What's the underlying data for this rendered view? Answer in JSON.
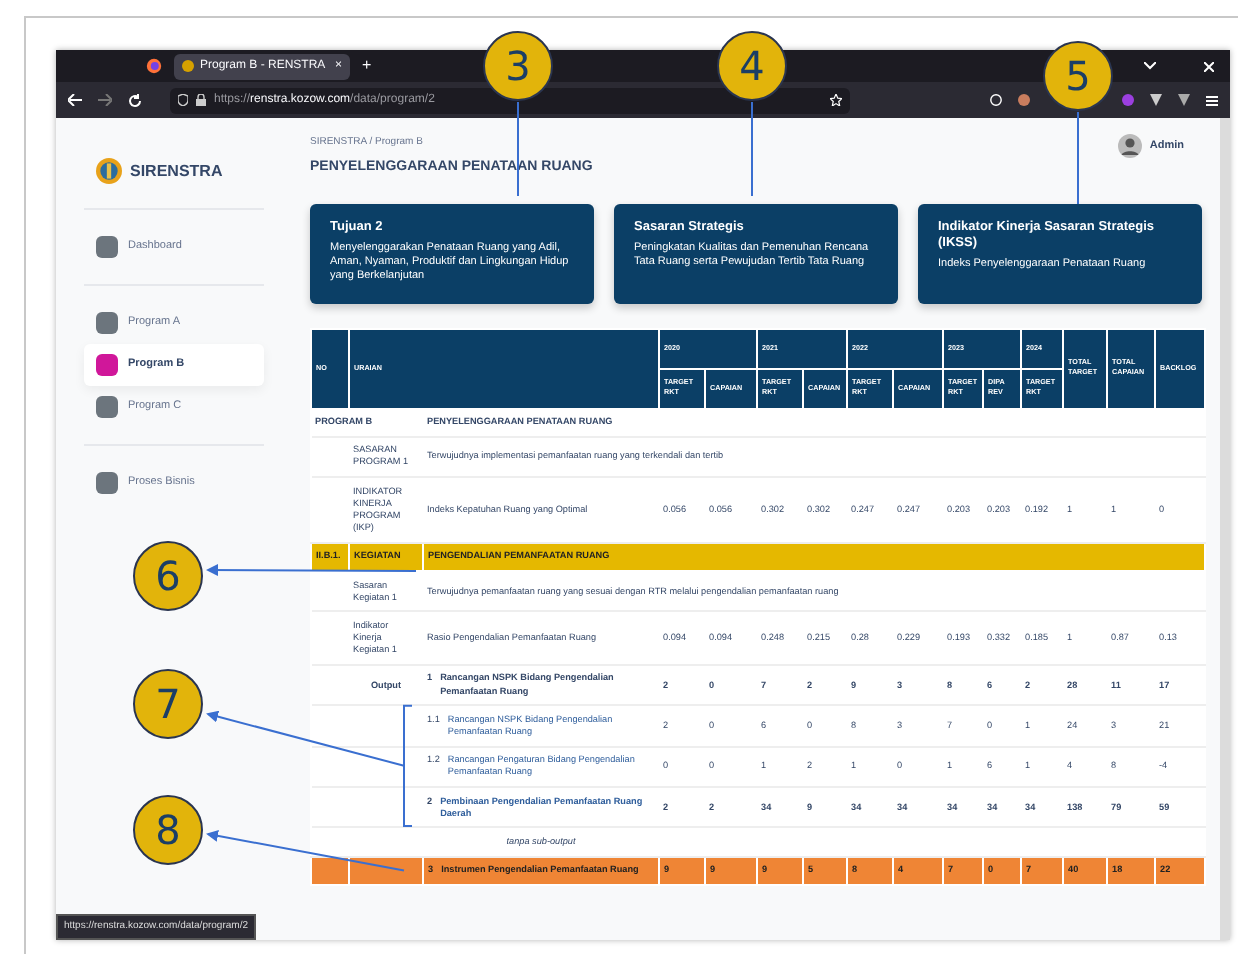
{
  "browser": {
    "tab_title": "Program B - RENSTRA",
    "tab_close": "×",
    "new_tab": "+",
    "url_scheme": "https://",
    "url_host": "renstra.kozow.com",
    "url_path": "/data/program/2",
    "status_url": "https://renstra.kozow.com/data/program/2"
  },
  "sidebar": {
    "brand": "SIRENSTRA",
    "groups": [
      [
        {
          "label": "Dashboard",
          "selected": false
        }
      ],
      [
        {
          "label": "Program A",
          "selected": false
        },
        {
          "label": "Program B",
          "selected": true
        },
        {
          "label": "Program C",
          "selected": false
        }
      ],
      [
        {
          "label": "Proses Bisnis",
          "selected": false
        }
      ]
    ]
  },
  "breadcrumb": {
    "items": [
      "SIRENSTRA",
      "Program B"
    ],
    "separator": "/"
  },
  "page_title": "PENYELENGGARAAN PENATAAN RUANG",
  "user": "Admin",
  "cards": [
    {
      "title": "Tujuan 2",
      "text": "Menyelenggarakan Penataan Ruang yang Adil, Aman, Nyaman, Produktif dan Lingkungan Hidup yang Berkelanjutan"
    },
    {
      "title": "Sasaran Strategis",
      "text": "Peningkatan Kualitas dan Pemenuhan Rencana Tata Ruang serta Pewujudan Tertib Tata Ruang"
    },
    {
      "title": "Indikator Kinerja Sasaran Strategis (IKSS)",
      "text": "Indeks Penyelenggaraan Penataan Ruang"
    }
  ],
  "table": {
    "columns": [
      {
        "label": "NO"
      },
      {
        "label": "URAIAN"
      },
      {
        "label": "2020",
        "sub": [
          "TARGET RKT",
          "CAPAIAN"
        ]
      },
      {
        "label": "2021",
        "sub": [
          "TARGET RKT",
          "CAPAIAN"
        ]
      },
      {
        "label": "2022",
        "sub": [
          "TARGET RKT",
          "CAPAIAN"
        ]
      },
      {
        "label": "2023",
        "sub": [
          "TARGET RKT",
          "DIPA REV"
        ]
      },
      {
        "label": "2024",
        "sub": [
          "TARGET RKT"
        ]
      },
      {
        "label": "TOTAL TARGET"
      },
      {
        "label": "TOTAL CAPAIAN"
      },
      {
        "label": "BACKLOG"
      }
    ],
    "rows": [
      {
        "kind": "program",
        "no": "PROGRAM B",
        "text": "PENYELENGGARAAN PENATAAN RUANG"
      },
      {
        "kind": "statement",
        "label": "SASARAN PROGRAM 1",
        "text": "Terwujudnya implementasi pemanfaatan ruang yang terkendali dan tertib"
      },
      {
        "kind": "indicator",
        "label": "INDIKATOR KINERJA PROGRAM (IKP)",
        "text": "Indeks Kepatuhan Ruang yang Optimal",
        "values": [
          "0.056",
          "0.056",
          "0.302",
          "0.302",
          "0.247",
          "0.247",
          "0.203",
          "0.203",
          "0.192",
          "1",
          "1",
          "0"
        ]
      },
      {
        "kind": "activity",
        "no": "II.B.1.",
        "label": "KEGIATAN",
        "text": "PENGENDALIAN PEMANFAATAN RUANG"
      },
      {
        "kind": "statement",
        "label": "Sasaran Kegiatan 1",
        "text": "Terwujudnya pemanfaatan ruang yang sesuai dengan RTR melalui pengendalian pemanfaatan ruang"
      },
      {
        "kind": "indicator",
        "label": "Indikator Kinerja Kegiatan 1",
        "text": "Rasio Pengendalian Pemanfaatan Ruang",
        "values": [
          "0.094",
          "0.094",
          "0.248",
          "0.215",
          "0.28",
          "0.229",
          "0.193",
          "0.332",
          "0.185",
          "1",
          "0.87",
          "0.13"
        ]
      },
      {
        "kind": "output",
        "label": "Output",
        "num": "1",
        "text": "Rancangan NSPK Bidang Pengendalian Pemanfaatan Ruang",
        "link": false,
        "values": [
          "2",
          "0",
          "7",
          "2",
          "9",
          "3",
          "8",
          "6",
          "2",
          "28",
          "11",
          "17"
        ]
      },
      {
        "kind": "sub_output",
        "num": "1.1",
        "text": "Rancangan NSPK Bidang Pengendalian Pemanfaatan Ruang",
        "values": [
          "2",
          "0",
          "6",
          "0",
          "8",
          "3",
          "7",
          "0",
          "1",
          "24",
          "3",
          "21"
        ]
      },
      {
        "kind": "sub_output",
        "num": "1.2",
        "text": "Rancangan Pengaturan Bidang Pengendalian Pemanfaatan Ruang",
        "values": [
          "0",
          "0",
          "1",
          "2",
          "1",
          "0",
          "1",
          "6",
          "1",
          "4",
          "8",
          "-4"
        ]
      },
      {
        "kind": "output",
        "num": "2",
        "text": "Pembinaan Pengendalian Pemanfaatan Ruang Daerah",
        "link": true,
        "values": [
          "2",
          "2",
          "34",
          "9",
          "34",
          "34",
          "34",
          "34",
          "34",
          "138",
          "79",
          "59"
        ]
      },
      {
        "kind": "note",
        "text": "tanpa sub-output"
      },
      {
        "kind": "highlight",
        "num": "3",
        "text": "Instrumen Pengendalian Pemanfaatan Ruang",
        "values": [
          "9",
          "9",
          "9",
          "5",
          "8",
          "4",
          "7",
          "0",
          "7",
          "40",
          "18",
          "22"
        ]
      }
    ]
  },
  "callouts": [
    {
      "label": "3"
    },
    {
      "label": "4"
    },
    {
      "label": "5"
    },
    {
      "label": "6"
    },
    {
      "label": "7"
    },
    {
      "label": "8"
    }
  ]
}
